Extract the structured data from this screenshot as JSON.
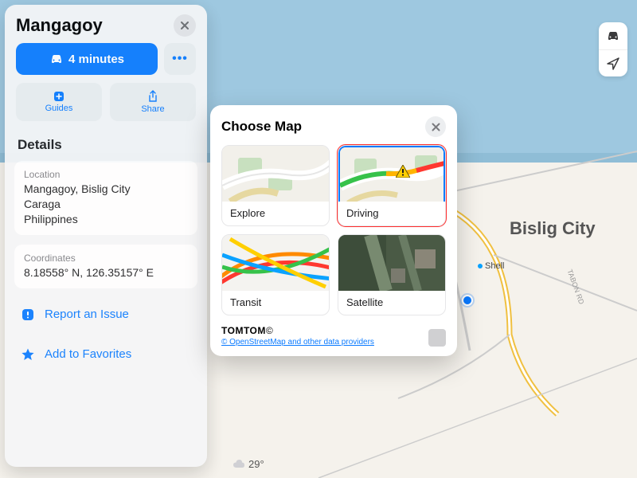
{
  "map": {
    "city_label": "Bislig City",
    "poi1": "Shell",
    "road_label": "TABON RD",
    "temperature": "29°"
  },
  "side": {
    "title": "Mangagoy",
    "directions_label": "4 minutes",
    "more_label": "•••",
    "guides_label": "Guides",
    "share_label": "Share",
    "details_heading": "Details",
    "location_label": "Location",
    "location_value": "Mangagoy, Bislig City\nCaraga\nPhilippines",
    "coords_label": "Coordinates",
    "coords_value": "8.18558° N, 126.35157° E",
    "report_label": "Report an Issue",
    "favorite_label": "Add to Favorites"
  },
  "modal": {
    "title": "Choose Map",
    "tiles": {
      "explore": "Explore",
      "driving": "Driving",
      "transit": "Transit",
      "satellite": "Satellite"
    },
    "brand": "TOMTOM",
    "attribution": "© OpenStreetMap and other data providers"
  }
}
